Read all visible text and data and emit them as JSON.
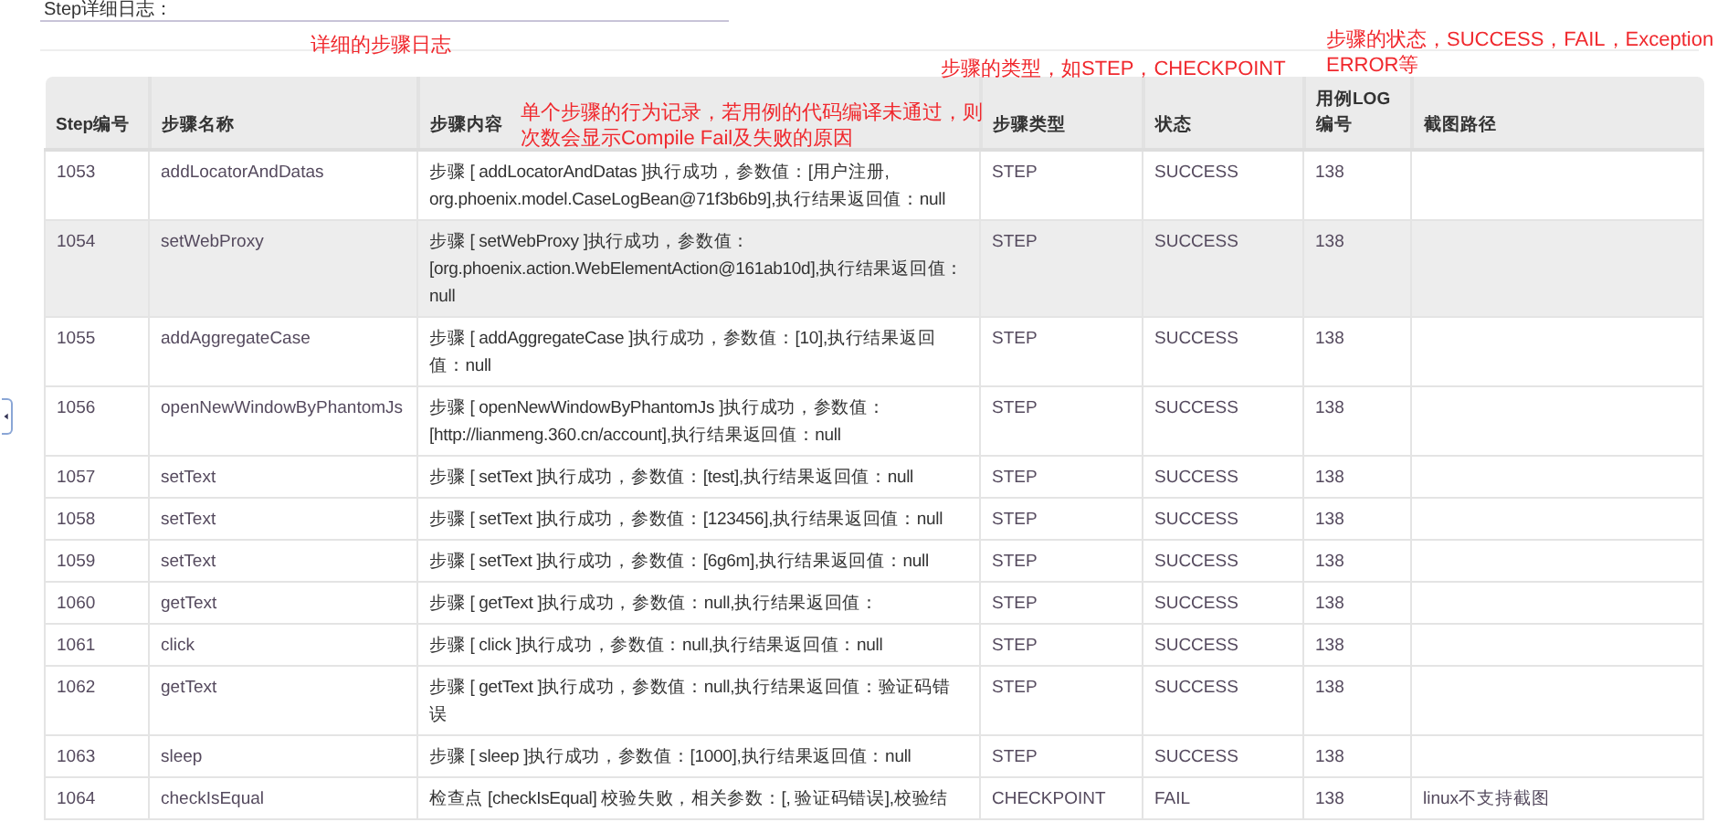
{
  "section_title": "Step详细日志：",
  "annotations": [
    {
      "lines": [
        "详细的步骤日志"
      ]
    },
    {
      "lines": [
        "单个步骤的行为记录，若用例的代码编译未通过，则",
        "次数会显示Compile Fail及失败的原因"
      ]
    },
    {
      "lines": [
        "步骤的类型，如STEP，CHECKPOINT"
      ]
    },
    {
      "lines": [
        "步骤的状态，SUCCESS，FAIL，Exception",
        "ERROR等"
      ]
    }
  ],
  "table": {
    "columns": [
      "Step编号",
      "步骤名称",
      "步骤内容",
      "步骤类型",
      "状态",
      "用例LOG编号",
      "截图路径"
    ],
    "rows": [
      {
        "highlighted": false,
        "cells": [
          "1053",
          "addLocatorAndDatas",
          "步骤 [ addLocatorAndDatas ]执行成功，参数值：[用户注册, org.phoenix.model.CaseLogBean@71f3b6b9],执行结果返回值：null",
          "STEP",
          "SUCCESS",
          "138",
          ""
        ]
      },
      {
        "highlighted": true,
        "cells": [
          "1054",
          "setWebProxy",
          "步骤 [ setWebProxy ]执行成功，参数值：[org.phoenix.action.WebElementAction@161ab10d],执行结果返回值：null",
          "STEP",
          "SUCCESS",
          "138",
          ""
        ]
      },
      {
        "highlighted": false,
        "cells": [
          "1055",
          "addAggregateCase",
          "步骤 [ addAggregateCase ]执行成功，参数值：[10],执行结果返回值：null",
          "STEP",
          "SUCCESS",
          "138",
          ""
        ]
      },
      {
        "highlighted": false,
        "cells": [
          "1056",
          "openNewWindowByPhantomJs",
          "步骤 [ openNewWindowByPhantomJs ]执行成功，参数值：[http://lianmeng.360.cn/account],执行结果返回值：null",
          "STEP",
          "SUCCESS",
          "138",
          ""
        ]
      },
      {
        "highlighted": false,
        "cells": [
          "1057",
          "setText",
          "步骤 [ setText ]执行成功，参数值：[test],执行结果返回值：null",
          "STEP",
          "SUCCESS",
          "138",
          ""
        ]
      },
      {
        "highlighted": false,
        "cells": [
          "1058",
          "setText",
          "步骤 [ setText ]执行成功，参数值：[123456],执行结果返回值：null",
          "STEP",
          "SUCCESS",
          "138",
          ""
        ]
      },
      {
        "highlighted": false,
        "cells": [
          "1059",
          "setText",
          "步骤 [ setText ]执行成功，参数值：[6g6m],执行结果返回值：null",
          "STEP",
          "SUCCESS",
          "138",
          ""
        ]
      },
      {
        "highlighted": false,
        "cells": [
          "1060",
          "getText",
          "步骤 [ getText ]执行成功，参数值：null,执行结果返回值：",
          "STEP",
          "SUCCESS",
          "138",
          ""
        ]
      },
      {
        "highlighted": false,
        "cells": [
          "1061",
          "click",
          "步骤 [ click ]执行成功，参数值：null,执行结果返回值：null",
          "STEP",
          "SUCCESS",
          "138",
          ""
        ]
      },
      {
        "highlighted": false,
        "cells": [
          "1062",
          "getText",
          "步骤 [ getText ]执行成功，参数值：null,执行结果返回值：验证码错误",
          "STEP",
          "SUCCESS",
          "138",
          ""
        ]
      },
      {
        "highlighted": false,
        "cells": [
          "1063",
          "sleep",
          "步骤 [ sleep ]执行成功，参数值：[1000],执行结果返回值：null",
          "STEP",
          "SUCCESS",
          "138",
          ""
        ]
      },
      {
        "highlighted": false,
        "cells": [
          "1064",
          "checkIsEqual",
          "检查点 [checkIsEqual] 校验失败，相关参数：[, 验证码错误],校验结",
          "CHECKPOINT",
          "FAIL",
          "138",
          "linux不支持截图"
        ]
      }
    ]
  }
}
